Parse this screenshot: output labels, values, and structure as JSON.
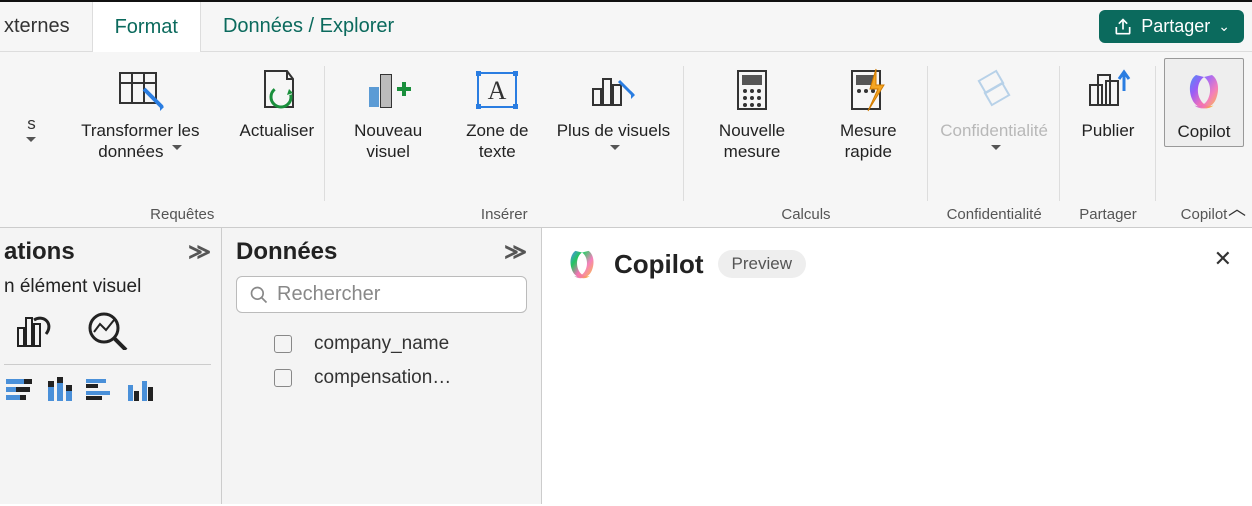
{
  "tabs": {
    "partial": "xternes",
    "format": "Format",
    "data_explore": "Données / Explorer"
  },
  "share": {
    "label": "Partager"
  },
  "ribbon": {
    "truncated": {
      "top": " ",
      "line1": "s",
      "chev": " "
    },
    "requests": {
      "transform": "Transformer les données",
      "refresh": "Actualiser",
      "group": "Requêtes"
    },
    "insert": {
      "new_visual": "Nouveau visuel",
      "text_box": "Zone de texte",
      "more_visuals": "Plus de visuels",
      "group": "Insérer"
    },
    "calcs": {
      "new_measure": "Nouvelle mesure",
      "quick_measure": "Mesure rapide",
      "group": "Calculs"
    },
    "confidentiality": {
      "label": "Confidentialité",
      "group": "Confidentialité"
    },
    "share_grp": {
      "publish": "Publier",
      "group": "Partager"
    },
    "copilot_grp": {
      "copilot": "Copilot",
      "group": "Copilot"
    }
  },
  "viz_pane": {
    "title_partial": "ations",
    "subtitle_partial": "n élément visuel"
  },
  "data_pane": {
    "title": "Données",
    "search_placeholder": "Rechercher",
    "fields": [
      "company_name",
      "compensation…"
    ]
  },
  "copilot_pane": {
    "title": "Copilot",
    "badge": "Preview"
  }
}
